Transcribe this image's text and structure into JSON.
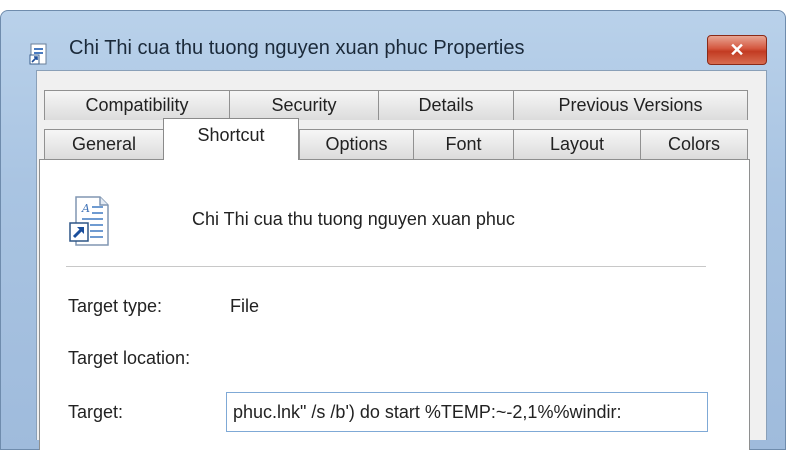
{
  "window": {
    "title": "Chi Thi cua thu tuong nguyen xuan phuc Properties",
    "close_glyph": "✕"
  },
  "tabs_row1": [
    {
      "label": "Compatibility"
    },
    {
      "label": "Security"
    },
    {
      "label": "Details"
    },
    {
      "label": "Previous Versions"
    }
  ],
  "tabs_row2": [
    {
      "label": "General"
    },
    {
      "label": "Shortcut",
      "active": true
    },
    {
      "label": "Options"
    },
    {
      "label": "Font"
    },
    {
      "label": "Layout"
    },
    {
      "label": "Colors"
    }
  ],
  "shortcut": {
    "name": "Chi Thi cua thu tuong nguyen xuan phuc",
    "target_type_label": "Target type:",
    "target_type_value": "File",
    "target_location_label": "Target location:",
    "target_label": "Target:",
    "target_value": "phuc.lnk\" /s /b') do start %TEMP:~-2,1%%windir:"
  },
  "icons": {
    "title": "shortcut-document-icon",
    "file": "shortcut-document-icon",
    "close": "close-icon"
  },
  "colors": {
    "close_button": "#c23b22",
    "frame": "#a9c4e2",
    "input_border": "#7fa9d6"
  }
}
